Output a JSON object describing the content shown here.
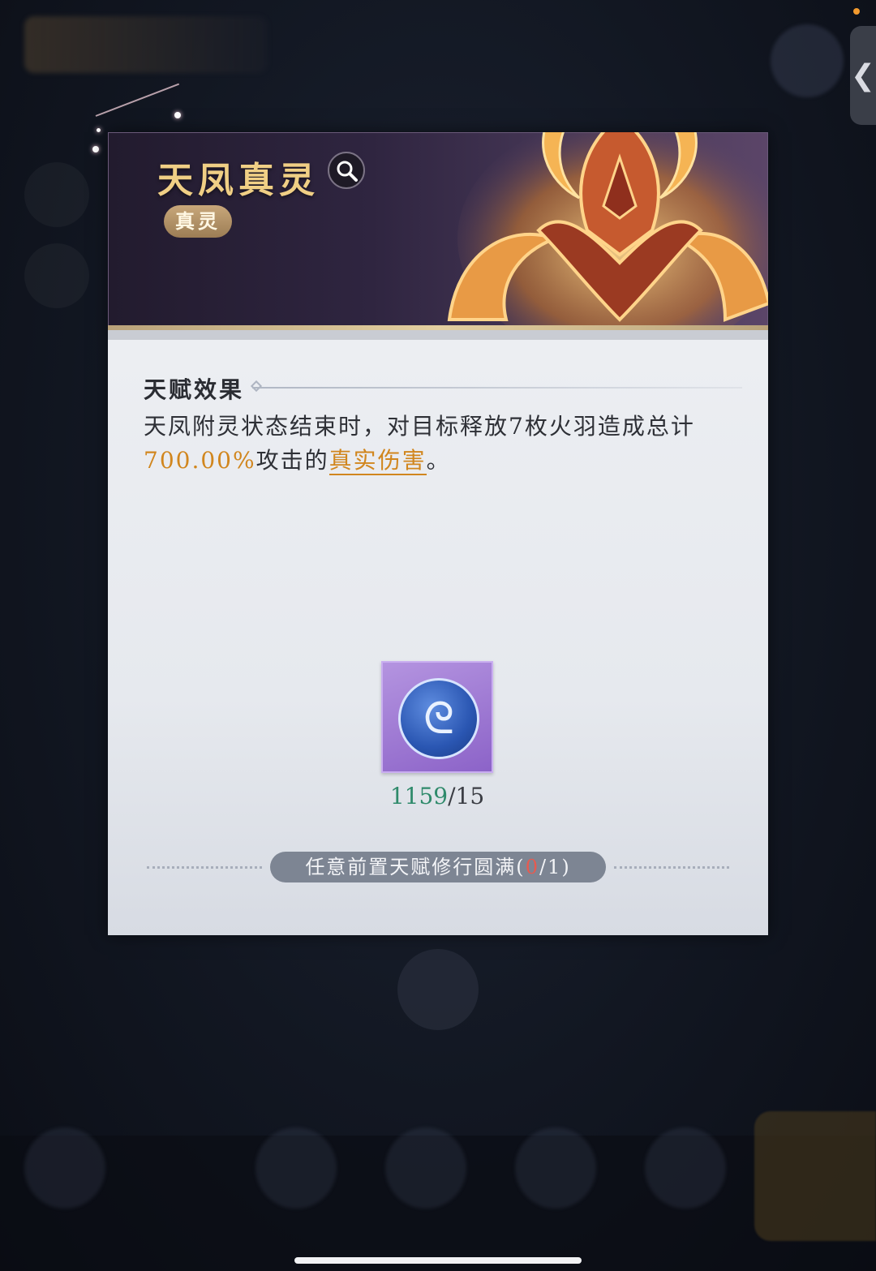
{
  "panel": {
    "title": "天凤真灵",
    "tag": "真灵",
    "section_title": "天赋效果",
    "description": {
      "part1": "天凤附灵状态结束时，对目标释放7枚火羽造成总计",
      "percent": "700.00%",
      "part2": "攻击的",
      "keyword": "真实伤害",
      "end": "。"
    },
    "cost_item": {
      "icon": "spirit-swirl-icon",
      "have": "1159",
      "separator": "/",
      "need": "15"
    },
    "requirement": {
      "text": "任意前置天赋修行圆满(",
      "progress_current": "0",
      "progress_rest": "/1)"
    }
  },
  "side_tab": {
    "label": "❮"
  },
  "colors": {
    "title_gold": "#f0cf85",
    "highlight_orange": "#d1861e",
    "have_green": "#2f8a6b",
    "warn_red": "#e85a4f"
  }
}
